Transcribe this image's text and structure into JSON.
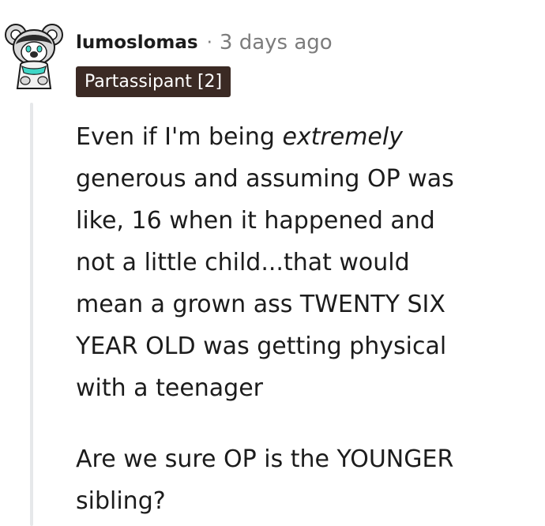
{
  "comment": {
    "author": "lumoslomas",
    "separator": "·",
    "timestamp": "3 days ago",
    "flair": "Partassipant [2]",
    "paragraph1": {
      "line1_pre": "Even if I'm being ",
      "line1_em": "extremely",
      "line2": "generous and assuming OP was",
      "line3": "like, 16 when it happened and",
      "line4": "not a little child...that would",
      "line5": "mean a grown ass TWENTY SIX",
      "line6": "YEAR OLD was getting physical",
      "line7": "with a teenager"
    },
    "paragraph2": {
      "line1": "Are we sure OP is the YOUNGER",
      "line2": "sibling?"
    }
  },
  "colors": {
    "flair_bg": "#3b2a24",
    "meta_gray": "#7c7c7c",
    "thread_line": "#e6e8ea",
    "avatar_accent": "#3fd6c6"
  },
  "icons": {
    "avatar": "snoo-koala-avatar-icon"
  }
}
